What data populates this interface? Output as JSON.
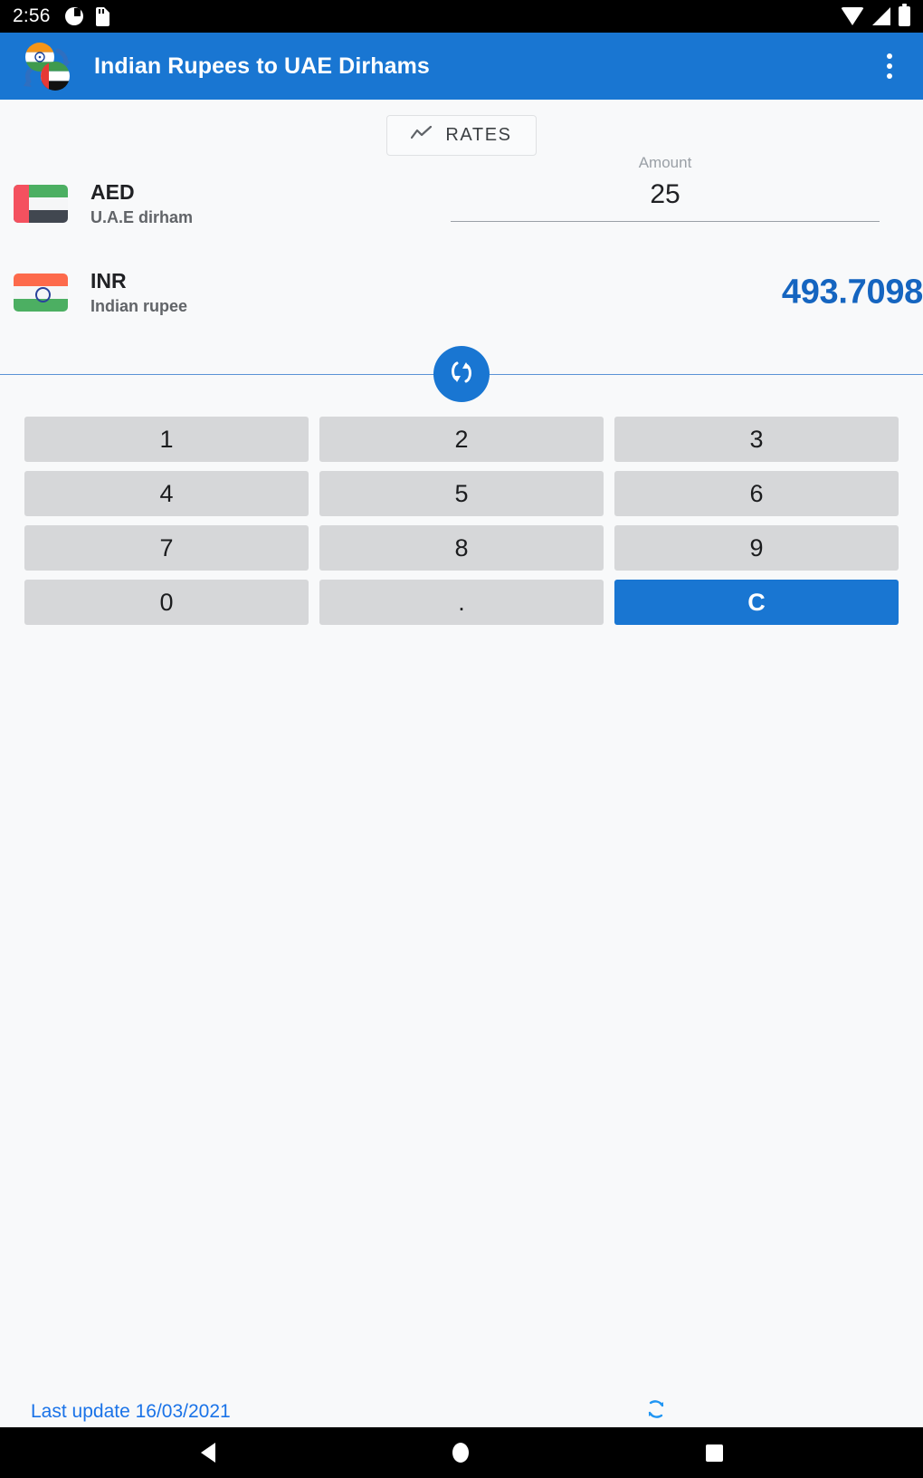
{
  "status_bar": {
    "time": "2:56",
    "left_icons": [
      "do-not-disturb-icon",
      "sd-card-icon"
    ],
    "right_icons": [
      "wifi-icon",
      "cellular-signal-icon",
      "battery-icon"
    ]
  },
  "app_bar": {
    "title": "Indian Rupees to UAE Dirhams",
    "icon": "app-logo-flags-icon",
    "overflow_label": "more-options",
    "background_color": "#1976d2"
  },
  "toolbar": {
    "rates_label": "RATES",
    "rates_icon": "trend-line-icon"
  },
  "converter": {
    "from": {
      "code": "AED",
      "name": "U.A.E dirham",
      "flag": "uae-flag-icon",
      "amount_label": "Amount",
      "amount_value": "25"
    },
    "to": {
      "code": "INR",
      "name": "Indian rupee",
      "flag": "india-flag-icon",
      "result_value": "493.7098",
      "result_color": "#1565c0"
    },
    "swap_icon": "swap-vertical-icon"
  },
  "keypad": {
    "rows": [
      [
        {
          "label": "1",
          "style": "normal"
        },
        {
          "label": "2",
          "style": "normal"
        },
        {
          "label": "3",
          "style": "normal"
        }
      ],
      [
        {
          "label": "4",
          "style": "normal"
        },
        {
          "label": "5",
          "style": "normal"
        },
        {
          "label": "6",
          "style": "normal"
        }
      ],
      [
        {
          "label": "7",
          "style": "normal"
        },
        {
          "label": "8",
          "style": "normal"
        },
        {
          "label": "9",
          "style": "normal"
        }
      ],
      [
        {
          "label": "0",
          "style": "normal"
        },
        {
          "label": ".",
          "style": "normal"
        },
        {
          "label": "C",
          "style": "accent"
        }
      ]
    ]
  },
  "footer": {
    "last_update": "Last update 16/03/2021",
    "refresh_icon": "refresh-icon",
    "link_color": "#1a73e8"
  },
  "nav_bar": {
    "back": "back-icon",
    "home": "home-icon",
    "recents": "recents-icon"
  }
}
